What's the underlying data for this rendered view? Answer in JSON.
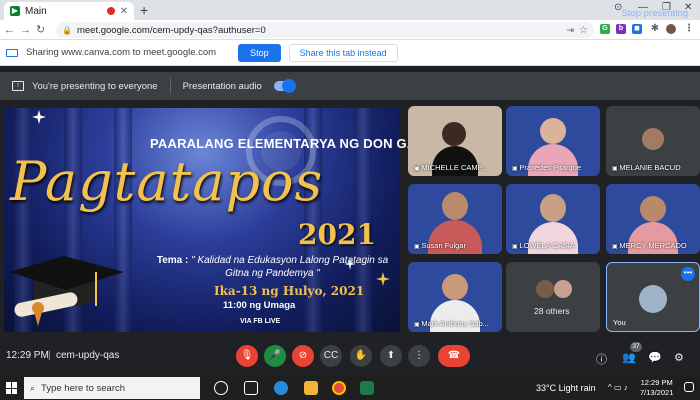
{
  "browser": {
    "tab_title": "Main",
    "url": "meet.google.com/cem-updy-qas?authuser=0",
    "minimize": "—",
    "maximize": "❐",
    "close": "✕"
  },
  "sharing": {
    "message": "Sharing www.canva.com to meet.google.com",
    "stop_label": "Stop",
    "share_tab_label": "Share this tab instead"
  },
  "presenting": {
    "status": "You're presenting to everyone",
    "audio_label": "Presentation audio",
    "audio_on": true,
    "stop_label": "Stop presenting"
  },
  "slide": {
    "school": "PAARALANG ELEMENTARYA NG DON GALO",
    "headline": "Pagtatapos",
    "year": "2021",
    "tema_label": "Tema :",
    "tema_text": "\" Kalidad na Edukasyon Lalong Patatagin sa Gitna ng Pandemya \"",
    "date": "Ika-13 ng Hulyo, 2021",
    "time": "11:00 ng Umaga",
    "via": "VIA FB LIVE"
  },
  "participants": [
    {
      "name": "MICHELLE CAMP...",
      "bg": "#c9b8a6"
    },
    {
      "name": "Praxedes Pitargue",
      "bg": "#2e4a9c"
    },
    {
      "name": "MELANIE BACUD",
      "bg": "#3c4043"
    },
    {
      "name": "Susan Fulgar",
      "bg": "#2e4a9c"
    },
    {
      "name": "LOWELA CASIA",
      "bg": "#2e4a9c"
    },
    {
      "name": "MERCY MERCADO",
      "bg": "#2e4a9c"
    },
    {
      "name": "Mark Anthony Sab...",
      "bg": "#2e4a9c"
    },
    {
      "name": "28 others",
      "bg": "#3c4043"
    },
    {
      "name": "You",
      "bg": "#3c4043"
    }
  ],
  "meetbar": {
    "time": "12:29 PM",
    "separator": "|",
    "meeting_code": "cem-updy-qas",
    "participant_count": "37"
  },
  "taskbar": {
    "search_placeholder": "Type here to search",
    "weather": "33°C  Light rain",
    "time": "12:29 PM",
    "date": "7/13/2021"
  },
  "colors": {
    "accent": "#1a73e8",
    "danger": "#ea4335",
    "gold": "#f2c14e"
  }
}
